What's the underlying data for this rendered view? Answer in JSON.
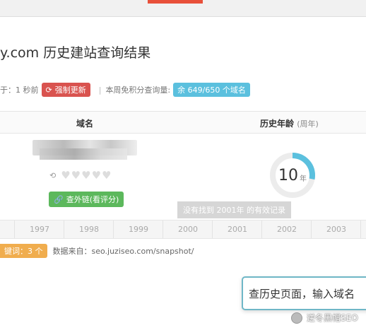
{
  "page": {
    "title": "y.com 历史建站查询结果"
  },
  "status_row": {
    "updated_prefix": "于：1 秒前",
    "force_update_label": "强制更新",
    "weekly_free_label": "本周免积分查询量:",
    "quota_badge": "余 649/650 个域名"
  },
  "table": {
    "col_domain": "域名",
    "col_age": "历史年龄",
    "col_age_unit": "(周年)",
    "external_links_button": "查外链(看评分)",
    "age_value": "10",
    "age_unit": "年",
    "age_ring_fraction": 0.28,
    "no_record_tip": "没有找到 2001年 的有效记录"
  },
  "timeline": {
    "years": [
      "1997",
      "1998",
      "1999",
      "2000",
      "2001",
      "2002",
      "2003"
    ]
  },
  "source_row": {
    "keywords_badge": "键词：3 个",
    "source_text": "数据来自：seo.juziseo.com/snapshot/"
  },
  "search_box": {
    "placeholder": "查历史页面，输入域名"
  },
  "watermark": {
    "text": "逆冬黑帽SEO"
  },
  "colors": {
    "accent_red": "#d9534f",
    "accent_blue": "#5bc0de",
    "accent_green": "#5cb85c",
    "accent_orange": "#f0ad4e",
    "gauge_ring": "#5bc0de"
  }
}
